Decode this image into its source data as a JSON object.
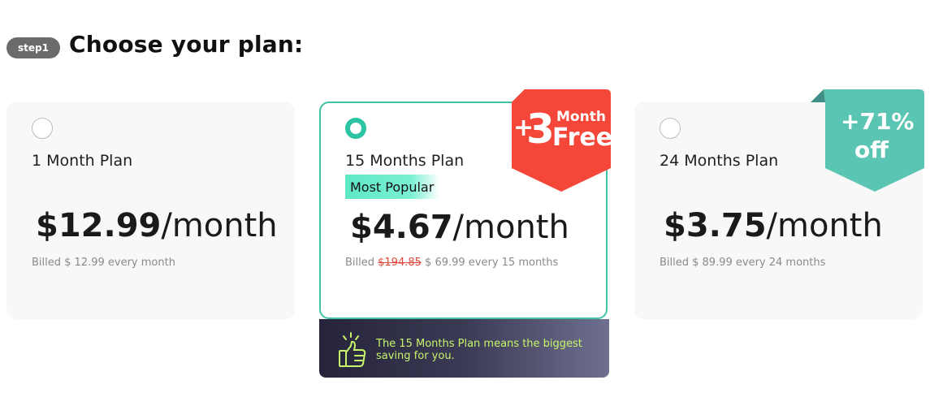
{
  "header": {
    "step_label": "step1",
    "title": "Choose your plan:"
  },
  "plans": [
    {
      "name": "1 Month Plan",
      "price": "$12.99",
      "unit": "/month",
      "billed_prefix": "Billed $ 12.99 every month",
      "selected": false
    },
    {
      "name": "15 Months Plan",
      "tag": "Most Popular",
      "price": "$4.67",
      "unit": "/month",
      "billed_prefix": "Billed ",
      "billed_strike": "$194.85",
      "billed_suffix": " $ 69.99 every 15 months",
      "selected": true,
      "ribbon": {
        "plus": "+",
        "number": "3",
        "line1": "Month",
        "line2": "Free"
      }
    },
    {
      "name": "24 Months Plan",
      "price": "$3.75",
      "unit": "/month",
      "billed_prefix": "Billed $ 89.99 every 24 months",
      "selected": false,
      "ribbon": {
        "line1": "+71%",
        "line2": "off"
      }
    }
  ],
  "promo": {
    "text": "The 15 Months Plan means the biggest saving for you.",
    "icon": "thumbs-up-icon"
  },
  "colors": {
    "accent_teal": "#2cc4a3",
    "ribbon_red": "#f4473a",
    "ribbon_teal": "#5ac5b2",
    "promo_text": "#c7f56a"
  }
}
